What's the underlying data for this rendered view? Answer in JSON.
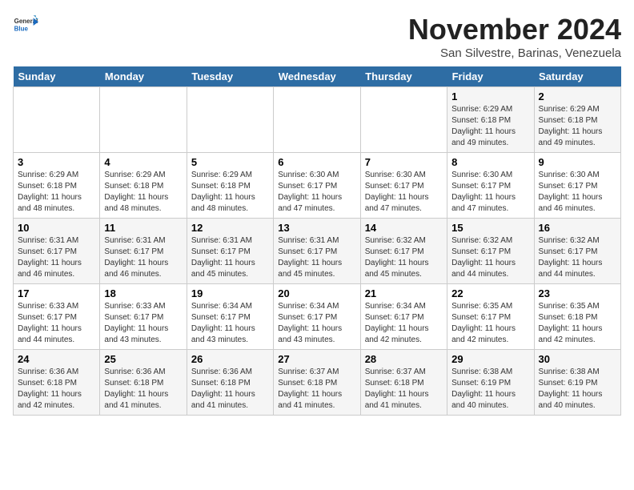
{
  "header": {
    "logo_general": "General",
    "logo_blue": "Blue",
    "month_title": "November 2024",
    "location": "San Silvestre, Barinas, Venezuela"
  },
  "weekdays": [
    "Sunday",
    "Monday",
    "Tuesday",
    "Wednesday",
    "Thursday",
    "Friday",
    "Saturday"
  ],
  "weeks": [
    [
      {
        "day": "",
        "content": ""
      },
      {
        "day": "",
        "content": ""
      },
      {
        "day": "",
        "content": ""
      },
      {
        "day": "",
        "content": ""
      },
      {
        "day": "",
        "content": ""
      },
      {
        "day": "1",
        "content": "Sunrise: 6:29 AM\nSunset: 6:18 PM\nDaylight: 11 hours and 49 minutes."
      },
      {
        "day": "2",
        "content": "Sunrise: 6:29 AM\nSunset: 6:18 PM\nDaylight: 11 hours and 49 minutes."
      }
    ],
    [
      {
        "day": "3",
        "content": "Sunrise: 6:29 AM\nSunset: 6:18 PM\nDaylight: 11 hours and 48 minutes."
      },
      {
        "day": "4",
        "content": "Sunrise: 6:29 AM\nSunset: 6:18 PM\nDaylight: 11 hours and 48 minutes."
      },
      {
        "day": "5",
        "content": "Sunrise: 6:29 AM\nSunset: 6:18 PM\nDaylight: 11 hours and 48 minutes."
      },
      {
        "day": "6",
        "content": "Sunrise: 6:30 AM\nSunset: 6:17 PM\nDaylight: 11 hours and 47 minutes."
      },
      {
        "day": "7",
        "content": "Sunrise: 6:30 AM\nSunset: 6:17 PM\nDaylight: 11 hours and 47 minutes."
      },
      {
        "day": "8",
        "content": "Sunrise: 6:30 AM\nSunset: 6:17 PM\nDaylight: 11 hours and 47 minutes."
      },
      {
        "day": "9",
        "content": "Sunrise: 6:30 AM\nSunset: 6:17 PM\nDaylight: 11 hours and 46 minutes."
      }
    ],
    [
      {
        "day": "10",
        "content": "Sunrise: 6:31 AM\nSunset: 6:17 PM\nDaylight: 11 hours and 46 minutes."
      },
      {
        "day": "11",
        "content": "Sunrise: 6:31 AM\nSunset: 6:17 PM\nDaylight: 11 hours and 46 minutes."
      },
      {
        "day": "12",
        "content": "Sunrise: 6:31 AM\nSunset: 6:17 PM\nDaylight: 11 hours and 45 minutes."
      },
      {
        "day": "13",
        "content": "Sunrise: 6:31 AM\nSunset: 6:17 PM\nDaylight: 11 hours and 45 minutes."
      },
      {
        "day": "14",
        "content": "Sunrise: 6:32 AM\nSunset: 6:17 PM\nDaylight: 11 hours and 45 minutes."
      },
      {
        "day": "15",
        "content": "Sunrise: 6:32 AM\nSunset: 6:17 PM\nDaylight: 11 hours and 44 minutes."
      },
      {
        "day": "16",
        "content": "Sunrise: 6:32 AM\nSunset: 6:17 PM\nDaylight: 11 hours and 44 minutes."
      }
    ],
    [
      {
        "day": "17",
        "content": "Sunrise: 6:33 AM\nSunset: 6:17 PM\nDaylight: 11 hours and 44 minutes."
      },
      {
        "day": "18",
        "content": "Sunrise: 6:33 AM\nSunset: 6:17 PM\nDaylight: 11 hours and 43 minutes."
      },
      {
        "day": "19",
        "content": "Sunrise: 6:34 AM\nSunset: 6:17 PM\nDaylight: 11 hours and 43 minutes."
      },
      {
        "day": "20",
        "content": "Sunrise: 6:34 AM\nSunset: 6:17 PM\nDaylight: 11 hours and 43 minutes."
      },
      {
        "day": "21",
        "content": "Sunrise: 6:34 AM\nSunset: 6:17 PM\nDaylight: 11 hours and 42 minutes."
      },
      {
        "day": "22",
        "content": "Sunrise: 6:35 AM\nSunset: 6:17 PM\nDaylight: 11 hours and 42 minutes."
      },
      {
        "day": "23",
        "content": "Sunrise: 6:35 AM\nSunset: 6:18 PM\nDaylight: 11 hours and 42 minutes."
      }
    ],
    [
      {
        "day": "24",
        "content": "Sunrise: 6:36 AM\nSunset: 6:18 PM\nDaylight: 11 hours and 42 minutes."
      },
      {
        "day": "25",
        "content": "Sunrise: 6:36 AM\nSunset: 6:18 PM\nDaylight: 11 hours and 41 minutes."
      },
      {
        "day": "26",
        "content": "Sunrise: 6:36 AM\nSunset: 6:18 PM\nDaylight: 11 hours and 41 minutes."
      },
      {
        "day": "27",
        "content": "Sunrise: 6:37 AM\nSunset: 6:18 PM\nDaylight: 11 hours and 41 minutes."
      },
      {
        "day": "28",
        "content": "Sunrise: 6:37 AM\nSunset: 6:18 PM\nDaylight: 11 hours and 41 minutes."
      },
      {
        "day": "29",
        "content": "Sunrise: 6:38 AM\nSunset: 6:19 PM\nDaylight: 11 hours and 40 minutes."
      },
      {
        "day": "30",
        "content": "Sunrise: 6:38 AM\nSunset: 6:19 PM\nDaylight: 11 hours and 40 minutes."
      }
    ]
  ]
}
